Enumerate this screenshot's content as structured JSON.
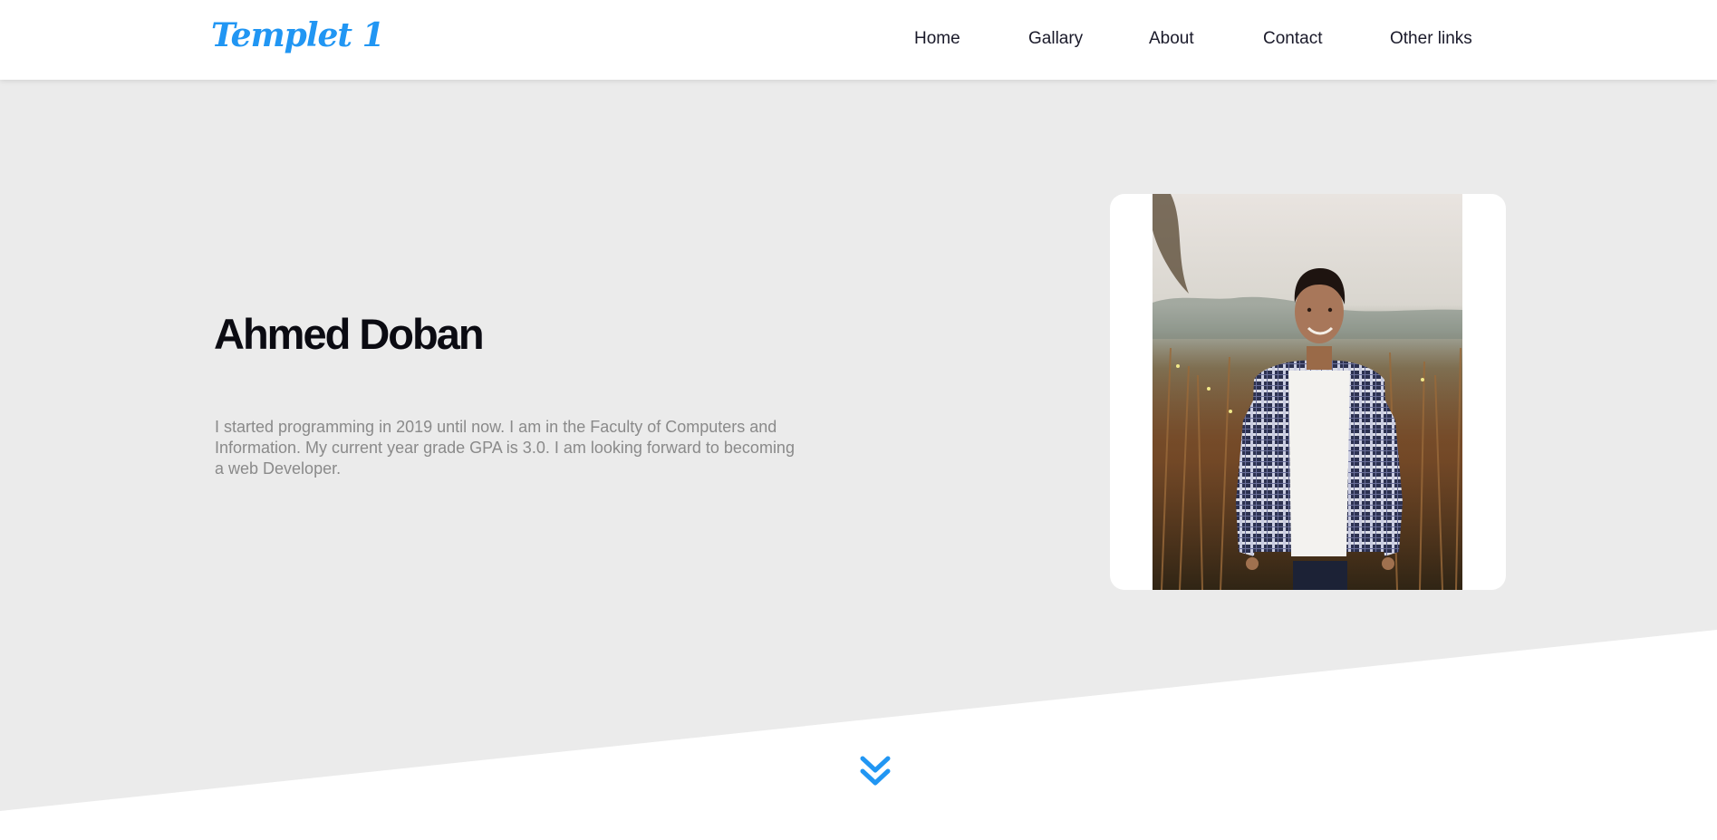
{
  "header": {
    "logo": "Templet 1",
    "nav": [
      {
        "label": "Home"
      },
      {
        "label": "Gallary"
      },
      {
        "label": "About"
      },
      {
        "label": "Contact"
      },
      {
        "label": "Other links"
      }
    ]
  },
  "hero": {
    "name": "Ahmed Doban",
    "bio": "I started programming in 2019 until now. I am in the Faculty of Computers and Information. My current year grade GPA is 3.0. I am looking forward to becoming a web Developer."
  },
  "colors": {
    "accent": "#2196f3",
    "hero_background": "#ebebeb",
    "heading": "#0b0b12",
    "body_text": "#8a8a8a"
  },
  "icons": {
    "scroll": "double-chevron-down-icon"
  }
}
